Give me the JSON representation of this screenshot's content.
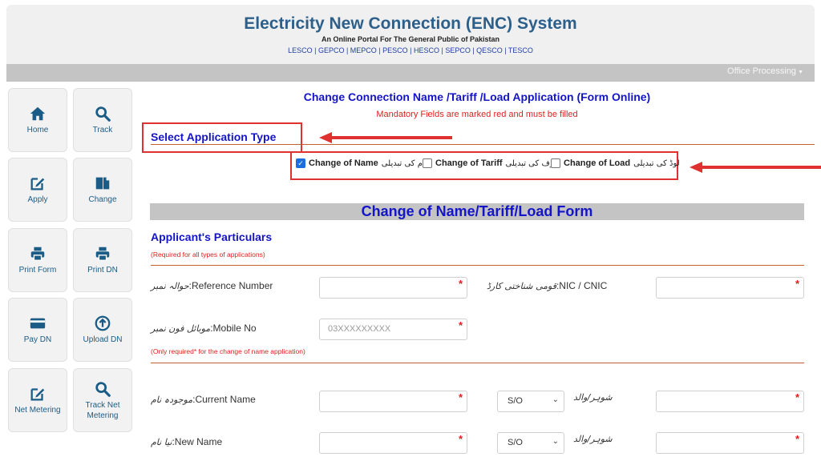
{
  "header": {
    "title": "Electricity New Connection (ENC) System",
    "subtitle": "An Online Portal For The General Public of Pakistan",
    "companies": "LESCO | GEPCO | MEPCO | PESCO | HESCO | SEPCO | QESCO | TESCO"
  },
  "navbar": {
    "office": "Office Processing"
  },
  "sidebar": {
    "tiles": [
      {
        "label": "Home",
        "icon": "home-icon"
      },
      {
        "label": "Track",
        "icon": "search-icon"
      },
      {
        "label": "Apply",
        "icon": "edit-icon"
      },
      {
        "label": "Change",
        "icon": "copy-icon"
      },
      {
        "label": "Print Form",
        "icon": "printer-icon"
      },
      {
        "label": "Print DN",
        "icon": "printer-icon"
      },
      {
        "label": "Pay DN",
        "icon": "card-icon"
      },
      {
        "label": "Upload DN",
        "icon": "upload-icon"
      },
      {
        "label": "Net Metering",
        "icon": "edit-icon"
      },
      {
        "label": "Track Net Metering",
        "icon": "search-icon"
      }
    ]
  },
  "form": {
    "title": "Change Connection Name /Tariff /Load Application (Form Online)",
    "mandatory_note": "Mandatory Fields are marked red and must be filled",
    "select_type_label": "Select Application Type",
    "options": [
      {
        "label": "Change of Name",
        "urdu": "نام کی تبدیلی",
        "checked": true
      },
      {
        "label": "Change of Tariff",
        "urdu": "ٹیرف کی تبدیلی",
        "checked": false
      },
      {
        "label": "Change of Load",
        "urdu": "لوڈ کی تبدیلی",
        "checked": false
      }
    ],
    "banner": "Change of Name/Tariff/Load Form",
    "section_title": "Applicant's Particulars",
    "section_note": "(Required for all types of applications)",
    "name_note": "(Only required* for the change of name application)",
    "fields": {
      "reference": {
        "urdu": "حوالہ نمبر",
        "label": ":Reference Number",
        "value": ""
      },
      "cnic": {
        "urdu": "قومی شناختی کارڈ",
        "label": ":NIC / CNIC",
        "value": ""
      },
      "mobile": {
        "urdu": "موبائل فون نمبر",
        "label": ":Mobile No",
        "placeholder": "03XXXXXXXXX"
      },
      "current_name": {
        "urdu": "موجودہ نام",
        "label": ":Current Name",
        "value": "",
        "relation": "S/O"
      },
      "new_name": {
        "urdu": "نیا نام",
        "label": ":New Name",
        "value": "",
        "relation": "S/O"
      },
      "father_label": "شوہر/والد"
    }
  },
  "colors": {
    "heading_blue": "#1414c8",
    "required_red": "#e21d1d",
    "highlight_red": "#e03131",
    "title_blue": "#2c5f8a"
  }
}
